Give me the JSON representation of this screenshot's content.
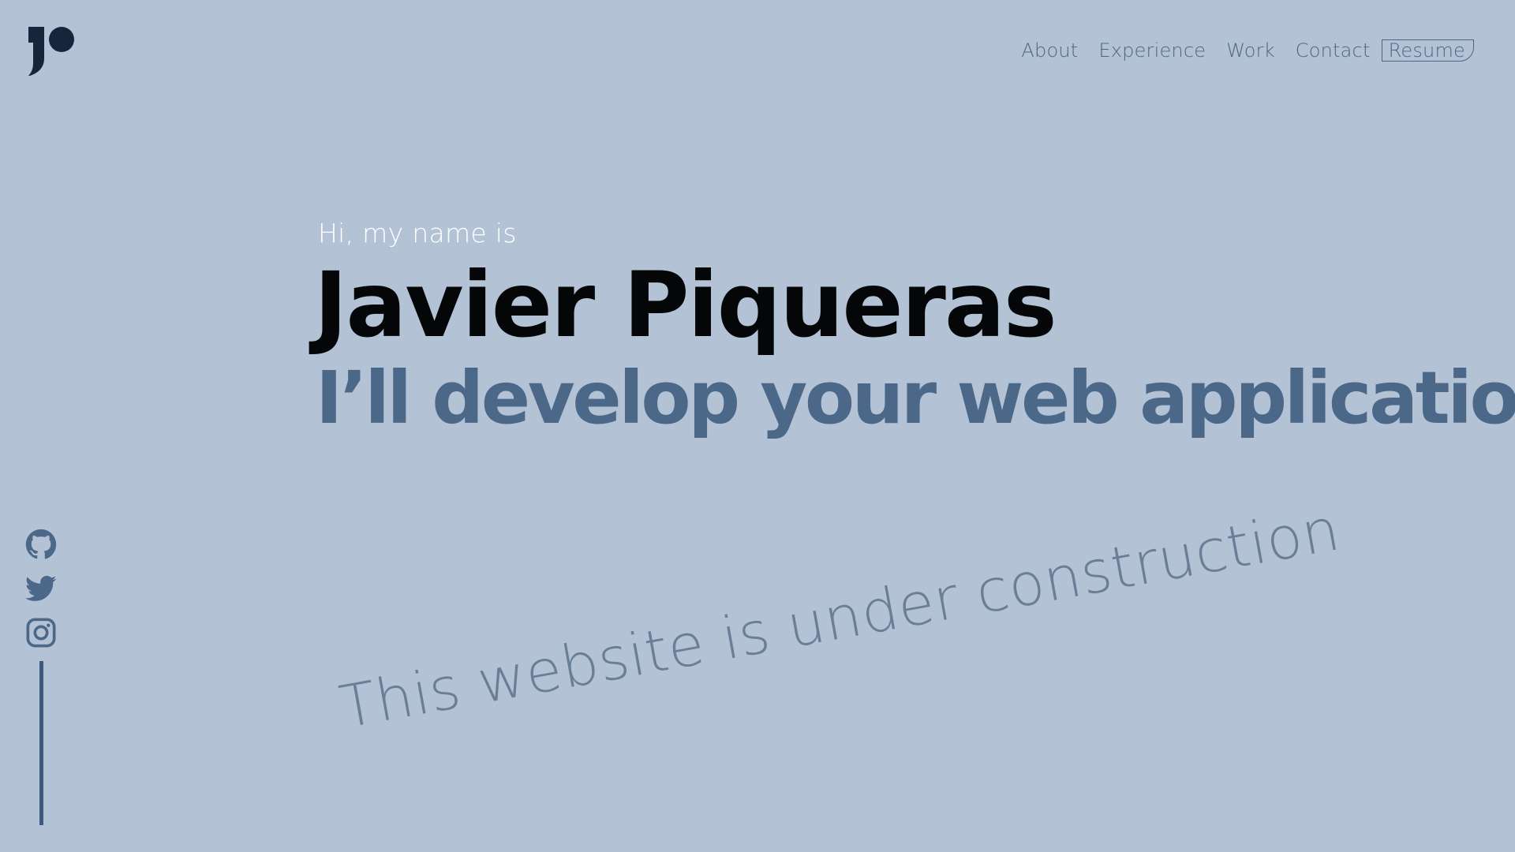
{
  "brand": {
    "logo_icon": "jp-logo-icon",
    "color": "#16243c"
  },
  "nav": {
    "items": [
      {
        "label": "About"
      },
      {
        "label": "Experience"
      },
      {
        "label": "Work"
      },
      {
        "label": "Contact"
      }
    ],
    "resume_label": "Resume"
  },
  "hero": {
    "intro": "Hi, my name is",
    "name": "Javier Piqueras",
    "tagline": "I’ll develop your web application",
    "notice": "This website is under construction"
  },
  "social": {
    "icons": [
      "github-icon",
      "twitter-icon",
      "instagram-icon"
    ]
  },
  "colors": {
    "background": "#b3c3d5",
    "accent": "#4b6889",
    "nav_text": "#4d6684",
    "name_text": "#050608",
    "intro_text": "#ffffff"
  }
}
